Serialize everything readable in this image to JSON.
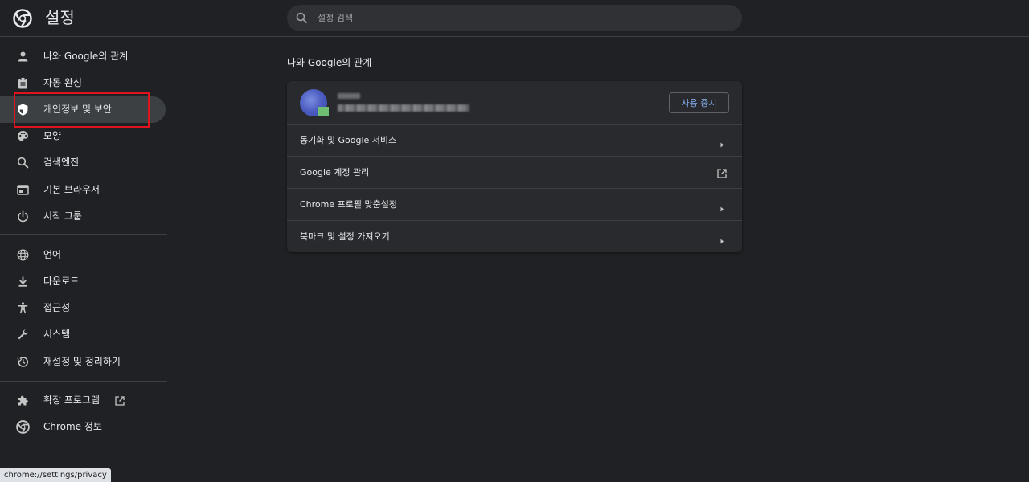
{
  "header": {
    "title": "설정",
    "search_placeholder": "설정 검색",
    "logo_icon": "chrome-logo-icon"
  },
  "sidebar": {
    "groups": [
      [
        {
          "label": "나와 Google의 관계",
          "icon": "person-icon"
        },
        {
          "label": "자동 완성",
          "icon": "clipboard-icon"
        },
        {
          "label": "개인정보 및 보안",
          "icon": "shield-icon",
          "active": true
        },
        {
          "label": "모양",
          "icon": "palette-icon"
        },
        {
          "label": "검색엔진",
          "icon": "search-icon"
        },
        {
          "label": "기본 브라우저",
          "icon": "browser-window-icon"
        },
        {
          "label": "시작 그룹",
          "icon": "power-icon"
        }
      ],
      [
        {
          "label": "언어",
          "icon": "globe-icon"
        },
        {
          "label": "다운로드",
          "icon": "download-icon"
        },
        {
          "label": "접근성",
          "icon": "accessibility-icon"
        },
        {
          "label": "시스템",
          "icon": "wrench-icon"
        },
        {
          "label": "재설정 및 정리하기",
          "icon": "history-icon"
        }
      ],
      [
        {
          "label": "확장 프로그램",
          "icon": "puzzle-icon",
          "external": true
        },
        {
          "label": "Chrome 정보",
          "icon": "chrome-logo-icon"
        }
      ]
    ]
  },
  "main": {
    "section_title": "나와 Google의 관계",
    "profile": {
      "signout_label": "사용 중지"
    },
    "rows": [
      {
        "label": "동기화 및 Google 서비스",
        "trailing": "arrow-right-icon"
      },
      {
        "label": "Google 계정 관리",
        "trailing": "external-link-icon"
      },
      {
        "label": "Chrome 프로필 맞춤설정",
        "trailing": "arrow-right-icon"
      },
      {
        "label": "북마크 및 설정 가져오기",
        "trailing": "arrow-right-icon"
      }
    ]
  },
  "status_bar": {
    "url": "chrome://settings/privacy"
  },
  "colors": {
    "background": "#202124",
    "card": "#292a2d",
    "active_item": "#3c4043",
    "accent": "#8ab4f8",
    "highlight": "#e0141e"
  }
}
